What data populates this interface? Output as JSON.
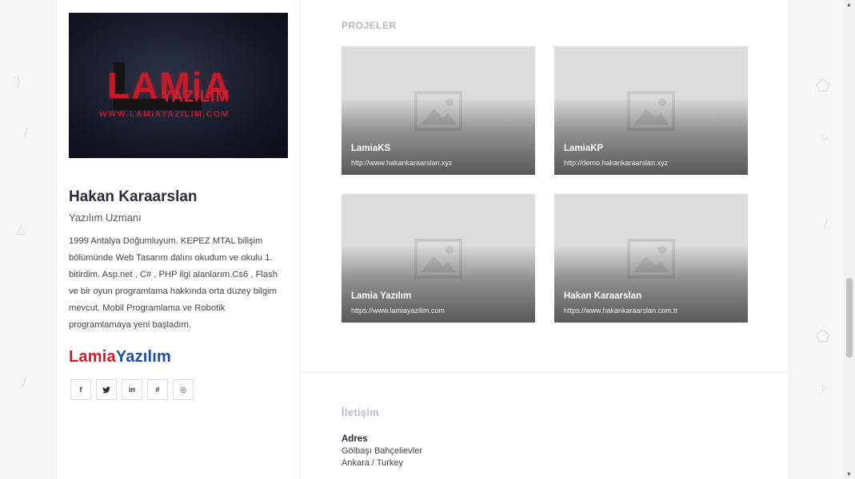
{
  "sidebar": {
    "banner": {
      "logo_main": "LAMiA",
      "logo_sub": "YAZILIM",
      "logo_url": "WWW.LAMiAYAZILIM.COM"
    },
    "name": "Hakan Karaarslan",
    "role": "Yazılım Uzmanı",
    "bio": "1999 Antalya Doğumluyum. KEPEZ MTAL bilişim bölümünde Web Tasarım dalını okudum ve okulu 1. bitirdim. Asp.net , C# , PHP ilgi alanlarım.Cs6 , Flash ve bir oyun programlama hakkında orta düzey bilgim mevcut. Mobil Programlama ve Robotik programlamaya yeni başladım.",
    "brand_part1": "Lamia",
    "brand_part2": "Yazılım",
    "socials": [
      {
        "icon": "facebook-icon",
        "glyph": "f"
      },
      {
        "icon": "twitter-icon",
        "glyph": "🐦"
      },
      {
        "icon": "linkedin-icon",
        "glyph": "in"
      },
      {
        "icon": "slack-icon",
        "glyph": "#"
      },
      {
        "icon": "dribbble-icon",
        "glyph": "◎"
      }
    ]
  },
  "projects": {
    "title": "PROJELER",
    "items": [
      {
        "title": "LamiaKS",
        "url": "http://www.hakankaraarslan.xyz"
      },
      {
        "title": "LamiaKP",
        "url": "http://demo.hakankaraarslan.xyz"
      },
      {
        "title": "Lamia Yazılım",
        "url": "https://www.lamiayazilim.com"
      },
      {
        "title": "Hakan Karaarslan",
        "url": "https://www.hakankaraarslan.com.tr"
      }
    ]
  },
  "contact": {
    "title": "İletişim",
    "address_label": "Adres",
    "address_line1": "Gölbaşı Bahçelievler",
    "address_line2": "Ankara / Turkey"
  },
  "colors": {
    "brand_red": "#d01b2c",
    "brand_blue": "#1f4e9e",
    "section_title": "#b6b6c8"
  }
}
